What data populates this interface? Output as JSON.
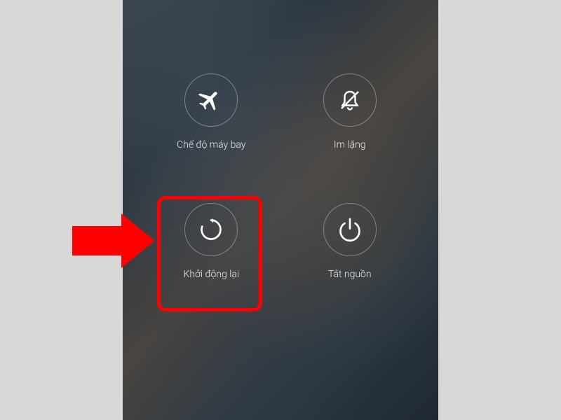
{
  "options": {
    "airplane": {
      "label": "Chế độ máy bay"
    },
    "silent": {
      "label": "Im lặng"
    },
    "restart": {
      "label": "Khởi động lại"
    },
    "poweroff": {
      "label": "Tắt nguồn"
    }
  },
  "annotation": {
    "highlighted_option": "restart"
  }
}
